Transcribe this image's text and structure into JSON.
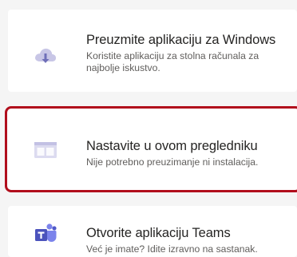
{
  "options": [
    {
      "id": "windows",
      "icon": "cloud-download-icon",
      "title": "Preuzmite aplikaciju za Windows",
      "description": "Koristite aplikaciju za stolna računala za najbolje iskustvo."
    },
    {
      "id": "browser",
      "icon": "browser-window-icon",
      "title": "Nastavite u ovom pregledniku",
      "description": "Nije potrebno preuzimanje ni instalacija.",
      "selected": true
    },
    {
      "id": "teams",
      "icon": "teams-logo-icon",
      "title": "Otvorite aplikaciju Teams",
      "description": "Već je imate? Idite izravno na sastanak."
    }
  ],
  "colors": {
    "highlight_border": "#b10e1c",
    "title_text": "#252423",
    "desc_text": "#605e5c",
    "teams_purple": "#5b5fc7"
  }
}
